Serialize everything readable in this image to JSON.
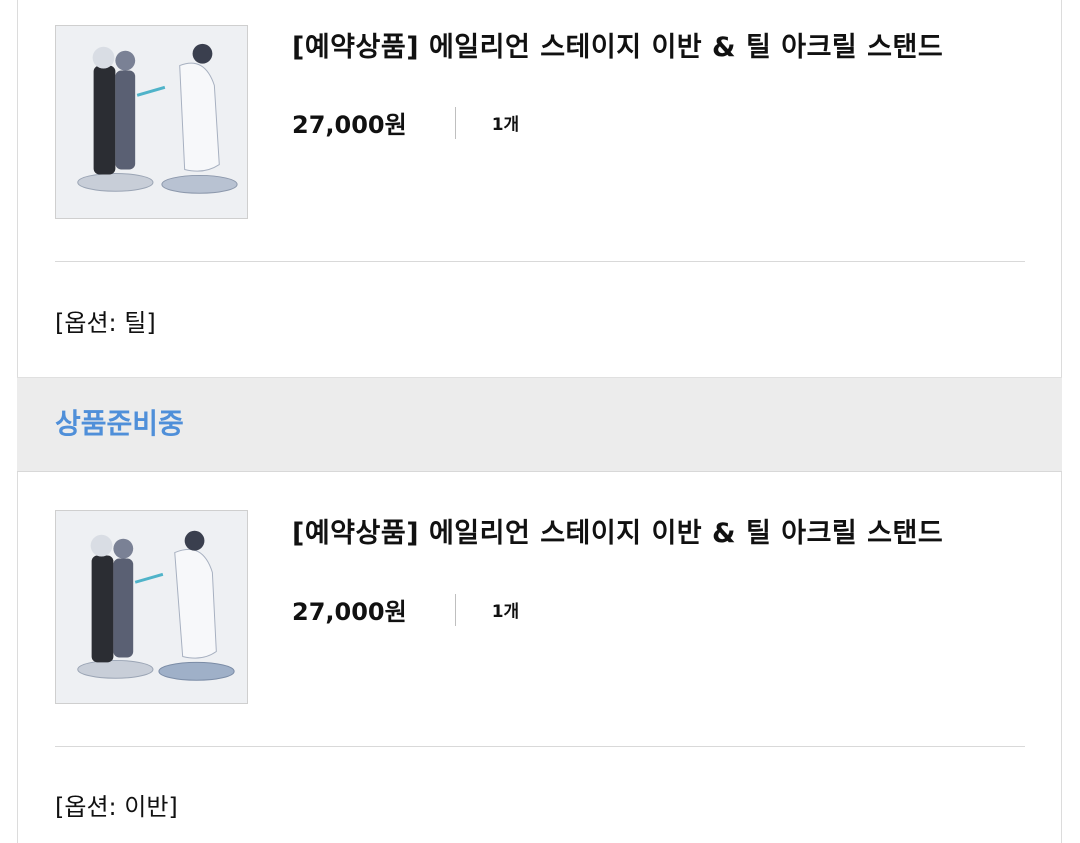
{
  "orders": [
    {
      "title": "[예약상품] 에일리언 스테이지 이반 & 틸 아크릴 스탠드",
      "price": "27,000원",
      "quantity": "1개",
      "option": "[옵션: 틸]",
      "image_icon": "acrylic-stand-image"
    },
    {
      "title": "[예약상품] 에일리언 스테이지 이반 & 틸 아크릴 스탠드",
      "price": "27,000원",
      "quantity": "1개",
      "option": "[옵션: 이반]",
      "image_icon": "acrylic-stand-image"
    }
  ],
  "status": {
    "label": "상품준비중",
    "color": "#4f8fd9"
  }
}
